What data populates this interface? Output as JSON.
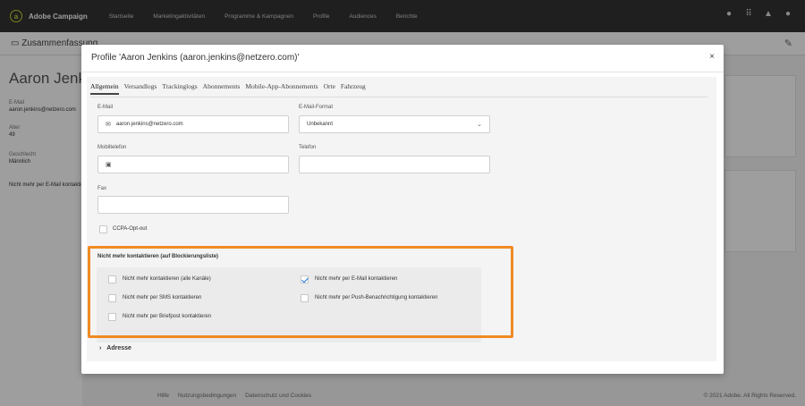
{
  "app": {
    "brand": "Adobe Campaign",
    "nav": [
      "Startseite",
      "Marketingaktivitäten",
      "Programme & Kampagnen",
      "Profile",
      "Audiences",
      "Berichte"
    ]
  },
  "subbar": {
    "summary": "Zusammenfassung"
  },
  "profile": {
    "name": "Aaron Jenkins",
    "email_label": "E-Mail",
    "email_value": "aaron.jenkins@netzero.com",
    "age_label": "Alter",
    "age_value": "49",
    "gender_label": "Geschlecht",
    "gender_value": "Männlich",
    "no_email": "Nicht mehr per E-Mail kontaktieren"
  },
  "footer": {
    "links": [
      "Hilfe",
      "Nutzungsbedingungen",
      "Datenschutz und Cookies"
    ],
    "copyright": "© 2021 Adobe. All Rights Reserved."
  },
  "modal": {
    "title": "Profile 'Aaron Jenkins (aaron.jenkins@netzero.com)'",
    "close": "×",
    "tabs": [
      "Allgemein",
      "Versandlogs",
      "Trackinglogs",
      "Abonnements",
      "Mobile-App-Abonnements",
      "Orte",
      "Fahrzeug"
    ],
    "fields": {
      "email_label": "E-Mail",
      "email_value": "aaron.jenkins@netzero.com",
      "email_format_label": "E-Mail-Format",
      "email_format_value": "Unbekannt",
      "mobile_label": "Mobiltelefon",
      "phone_label": "Telefon",
      "fax_label": "Fax",
      "ccpa_label": "CCPA-Opt-out"
    },
    "blocklist": {
      "title": "Nicht mehr kontaktieren (auf Blockierungsliste)",
      "options": [
        {
          "label": "Nicht mehr kontaktieren (alle Kanäle)",
          "checked": false
        },
        {
          "label": "Nicht mehr per E-Mail kontaktieren",
          "checked": true
        },
        {
          "label": "Nicht mehr per SMS kontaktieren",
          "checked": false
        },
        {
          "label": "Nicht mehr per Push-Benachrichtigung kontaktieren",
          "checked": false
        },
        {
          "label": "Nicht mehr per Briefpost kontaktieren",
          "checked": false
        }
      ]
    },
    "address_label": "Adresse"
  },
  "colors": {
    "highlight": "#f08a24",
    "accent": "#1473e6",
    "topbar": "#323232"
  }
}
